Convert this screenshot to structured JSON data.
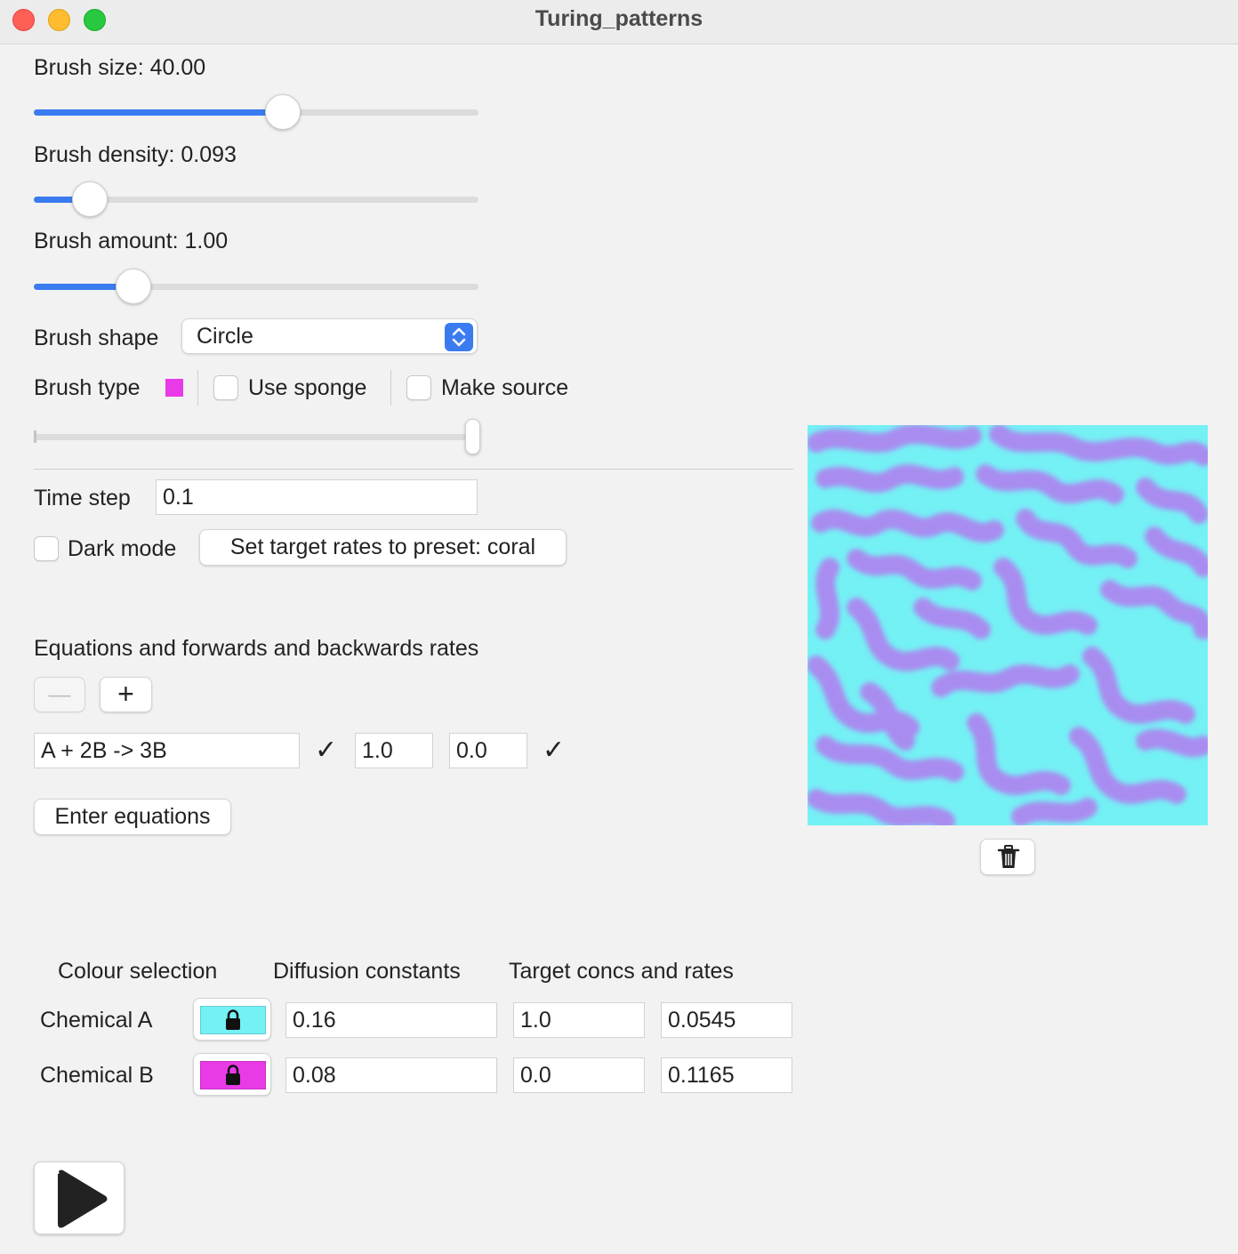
{
  "window": {
    "title": "Turing_patterns"
  },
  "brush": {
    "size_label": "Brush size: 40.00",
    "size_value": 40.0,
    "size_fraction": 0.56,
    "density_label": "Brush density: 0.093",
    "density_value": 0.093,
    "density_fraction": 0.125,
    "amount_label": "Brush amount: 1.00",
    "amount_value": 1.0,
    "amount_fraction": 0.224,
    "shape_label": "Brush shape",
    "shape_value": "Circle",
    "type_label": "Brush type",
    "type_color": "#e93ae7",
    "use_sponge_label": "Use sponge",
    "use_sponge_checked": false,
    "make_source_label": "Make source",
    "make_source_checked": false,
    "source_level_fraction": 1.0
  },
  "time": {
    "label": "Time step",
    "value": "0.1"
  },
  "dark_mode": {
    "label": "Dark mode",
    "checked": false
  },
  "preset_button": "Set target rates to preset: coral",
  "equations": {
    "heading": "Equations and forwards and backwards rates",
    "remove_label": "—",
    "add_label": "+",
    "rows": [
      {
        "equation": "A + 2B -> 3B",
        "forward": "1.0",
        "backward": "0.0",
        "valid_mark": "✓",
        "rates_valid_mark": "✓"
      }
    ],
    "enter_button": "Enter equations"
  },
  "table": {
    "col_colour": "Colour selection",
    "col_diffusion": "Diffusion constants",
    "col_target": "Target concs and rates",
    "chemicals": [
      {
        "name": "Chemical A",
        "color": "#74f1f5",
        "diffusion": "0.16",
        "target_conc": "1.0",
        "rate": "0.0545"
      },
      {
        "name": "Chemical B",
        "color": "#e93ae7",
        "diffusion": "0.08",
        "target_conc": "0.0",
        "rate": "0.1165"
      }
    ]
  },
  "colors": {
    "accent": "#3a7cf0",
    "pattern_background": "#74f1f5",
    "pattern_blob": "#a98cf0"
  },
  "icons": {
    "play": "play-icon",
    "trash": "trash-icon",
    "lock": "lock-icon",
    "select": "chevron-updown-icon"
  }
}
